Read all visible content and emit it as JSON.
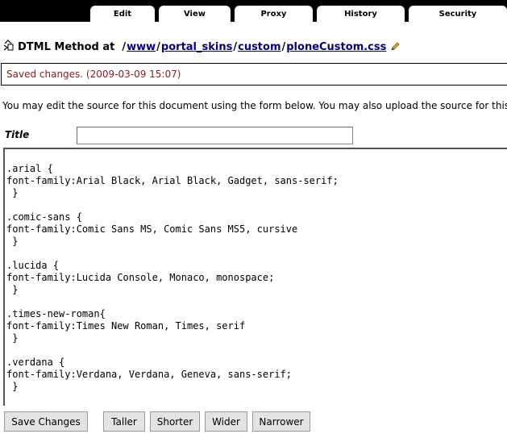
{
  "tabs": [
    {
      "label": "Edit",
      "active": true
    },
    {
      "label": "View"
    },
    {
      "label": "Proxy"
    },
    {
      "label": "History"
    },
    {
      "label": "Security"
    }
  ],
  "header": {
    "type_label": "DTML Method at",
    "path": [
      "/",
      "www",
      "/",
      "portal_skins",
      "/",
      "custom",
      "/",
      "ploneCustom.css"
    ]
  },
  "status_message": "Saved changes. (2009-03-09 15:07)",
  "intro_text": "You may edit the source for this document using the form below. You may also upload the source for this do",
  "form": {
    "title_label": "Title",
    "title_value": "",
    "source_lines": [
      ".arial {",
      "font-family:Arial Black, Arial Black, Gadget, sans-serif;",
      " }",
      "",
      ".comic-sans {",
      "font-family:Comic Sans MS, Comic Sans MS5, cursive",
      " }",
      "",
      ".lucida {",
      "font-family:Lucida Console, Monaco, monospace;",
      " }",
      "",
      ".times-new-roman{",
      "font-family:Times New Roman, Times, serif",
      " }",
      "",
      ".verdana {",
      "font-family:Verdana, Verdana, Geneva, sans-serif;",
      " }"
    ]
  },
  "buttons": {
    "save": "Save Changes",
    "taller": "Taller",
    "shorter": "Shorter",
    "wider": "Wider",
    "narrower": "Narrower"
  },
  "colors": {
    "tabbar_bg": "#000000",
    "link": "#000080",
    "status_text": "#8b1a1a"
  }
}
